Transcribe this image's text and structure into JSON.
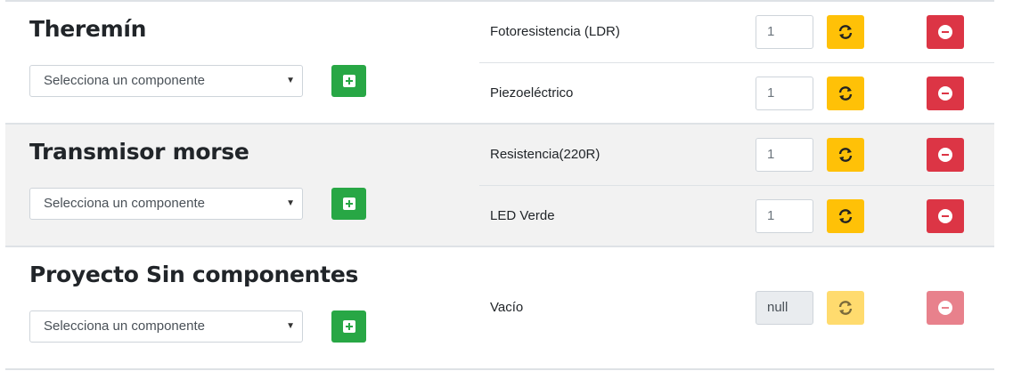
{
  "projects": [
    {
      "title": "Theremín",
      "select_placeholder": "Selecciona un componente",
      "components": [
        {
          "name": "Fotoresistencia (LDR)",
          "quantity": "1"
        },
        {
          "name": "Piezoeléctrico",
          "quantity": "1"
        }
      ]
    },
    {
      "title": "Transmisor morse",
      "select_placeholder": "Selecciona un componente",
      "components": [
        {
          "name": "Resistencia(220R)",
          "quantity": "1"
        },
        {
          "name": "LED Verde",
          "quantity": "1"
        }
      ]
    },
    {
      "title": "Proyecto Sin componentes",
      "select_placeholder": "Selecciona un componente",
      "components": [
        {
          "name": "Vacío",
          "quantity": "null"
        }
      ]
    }
  ],
  "icons": {
    "add": "plus-square-icon",
    "refresh": "sync-icon",
    "remove": "minus-circle-icon",
    "caret": "caret-down-icon"
  },
  "colors": {
    "add_button": "#28a745",
    "refresh_button": "#ffc107",
    "remove_button": "#dc3545",
    "striped_row": "#f2f2f2"
  }
}
